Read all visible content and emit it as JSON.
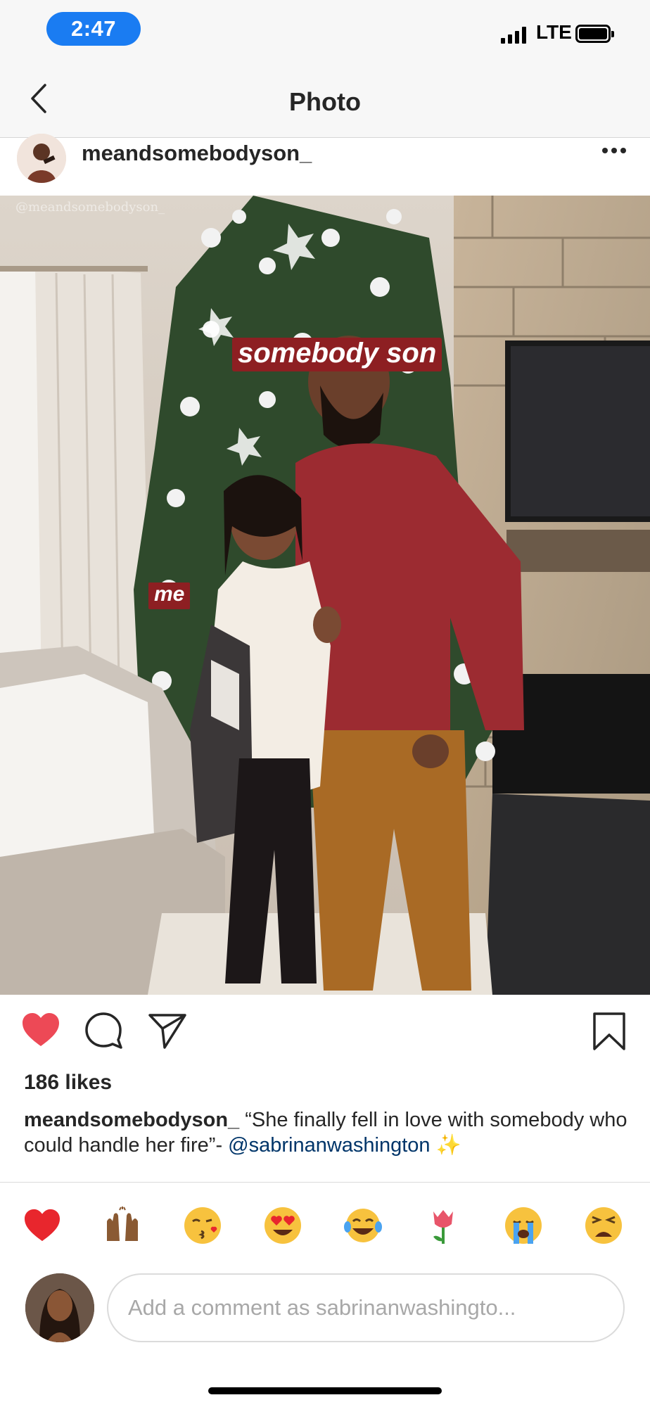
{
  "status": {
    "time": "2:47",
    "network": "LTE",
    "signal_icon": "signal-bars-icon",
    "battery_icon": "battery-icon",
    "accent": "#1a7cf2"
  },
  "nav": {
    "title": "Photo",
    "back_icon": "chevron-left-icon"
  },
  "post": {
    "username": "meandsomebodyson_",
    "more_icon": "ellipsis-icon",
    "photo": {
      "watermark": "@meandsomebodyson_",
      "tag_son": "somebody son",
      "tag_me": "me",
      "tag_color": "#8d1f22"
    },
    "actions": {
      "like_icon": "heart-filled-icon",
      "comment_icon": "comment-icon",
      "share_icon": "paper-plane-icon",
      "save_icon": "bookmark-icon",
      "like_color": "#ed4956"
    },
    "likes": "186 likes",
    "caption": {
      "user": "meandsomebodyson_",
      "text": " “She finally fell in love with somebody who could handle her fire”- ",
      "mention": "@sabrinanwashington",
      "emoji": " ✨"
    }
  },
  "quick_reactions": [
    "❤️",
    "🙌🏾",
    "😘",
    "😍",
    "😂",
    "🌷",
    "😭",
    "😩"
  ],
  "comment": {
    "placeholder": "Add a comment as sabrinanwashingto..."
  }
}
